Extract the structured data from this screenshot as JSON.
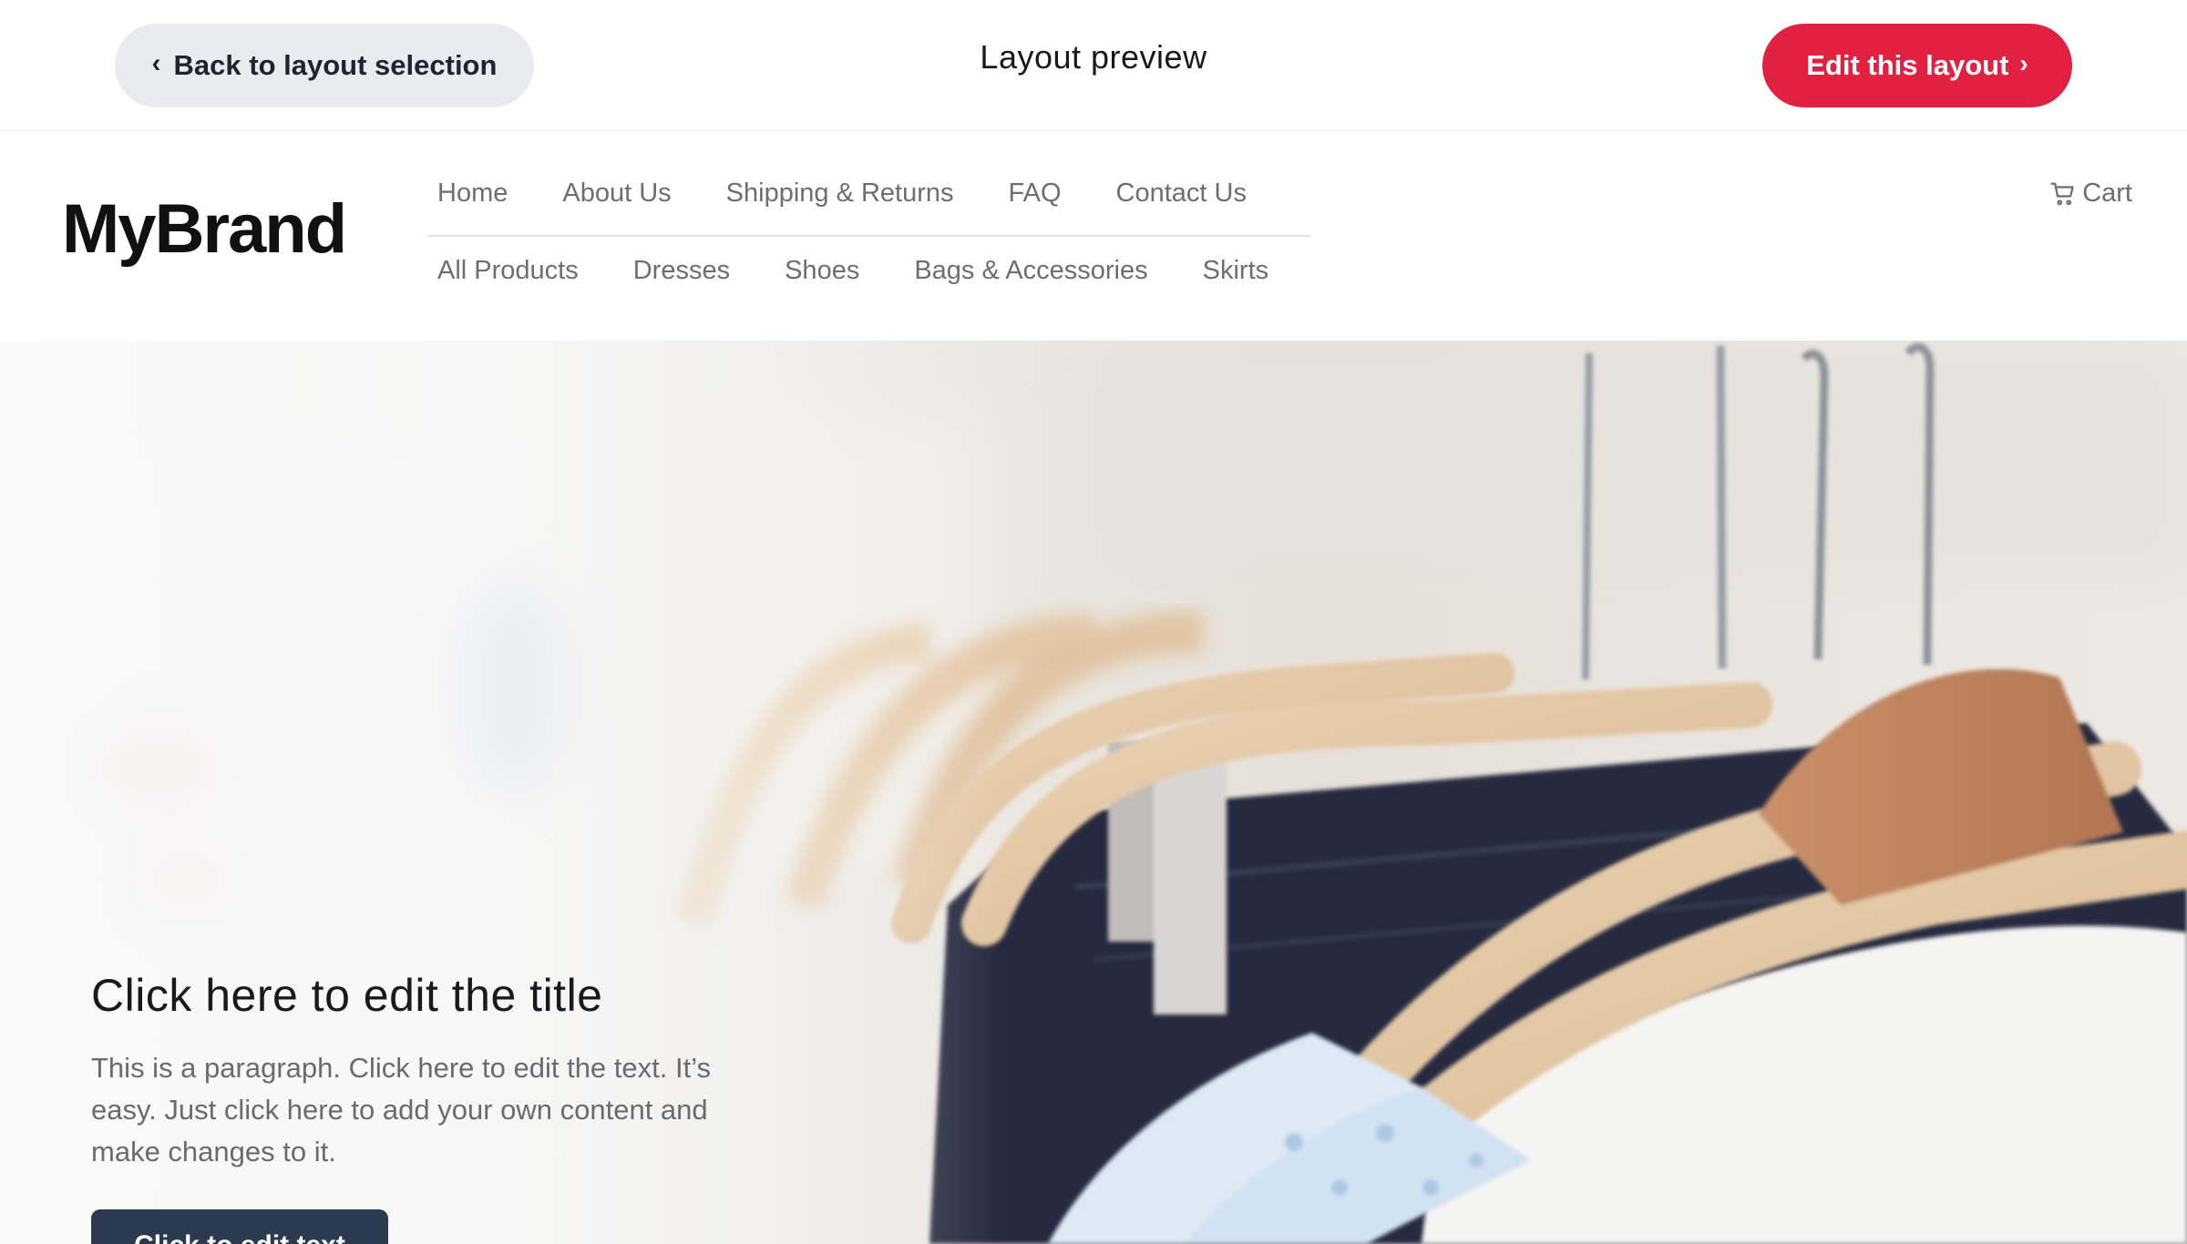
{
  "preview_bar": {
    "back_label": "Back to layout selection",
    "title": "Layout preview",
    "edit_label": "Edit this layout"
  },
  "header": {
    "brand": "MyBrand",
    "nav_primary": [
      "Home",
      "About Us",
      "Shipping & Returns",
      "FAQ",
      "Contact Us"
    ],
    "nav_secondary": [
      "All Products",
      "Dresses",
      "Shoes",
      "Bags & Accessories",
      "Skirts"
    ],
    "cart_label": "Cart",
    "cart_icon": "cart-icon"
  },
  "hero": {
    "title": "Click here to edit the title",
    "paragraph": "This is a paragraph. Click here to edit the text. It’s easy. Just click here to add your own content and make changes to it.",
    "button_label": "Click to edit text"
  },
  "colors": {
    "accent": "#e2203f",
    "back_button_bg": "#e9ebf0",
    "cta_bg": "#2c3a4f",
    "nav_text": "#6e6e6e"
  }
}
